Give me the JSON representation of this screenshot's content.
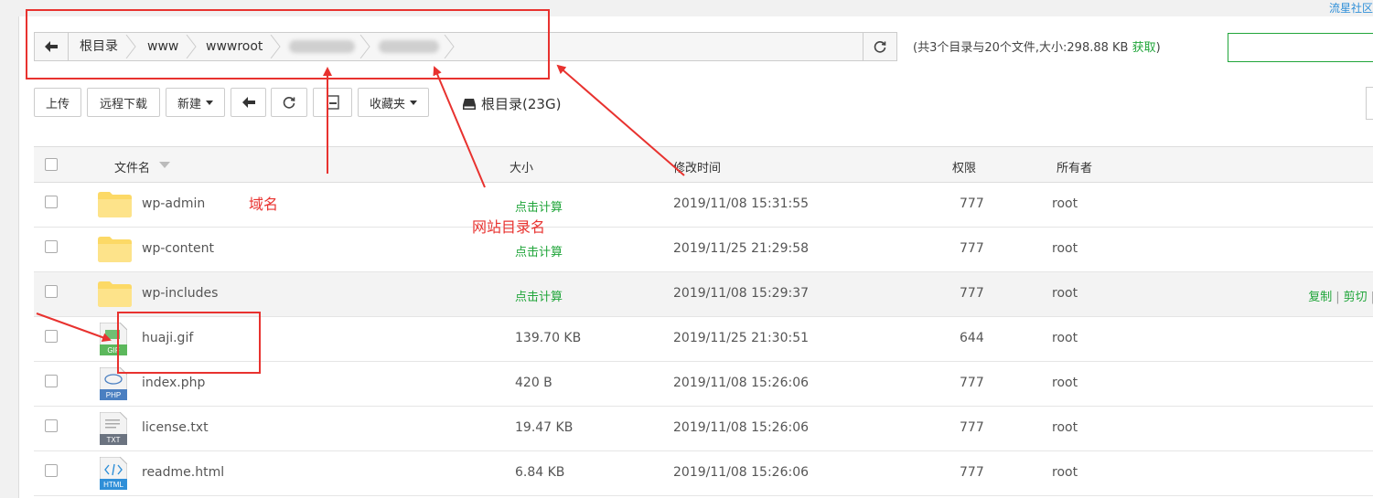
{
  "top_link": "流星社区",
  "breadcrumb": {
    "items": [
      "根目录",
      "www",
      "wwwroot"
    ]
  },
  "summary": {
    "text": "(共3个目录与20个文件,大小:298.88 KB",
    "get_label": "获取",
    "close": ")"
  },
  "toolbar": {
    "upload": "上传",
    "remote_download": "远程下载",
    "new": "新建",
    "favorites": "收藏夹",
    "disk_label": "根目录(23G)"
  },
  "table": {
    "headers": {
      "name": "文件名",
      "size": "大小",
      "mtime": "修改时间",
      "perm": "权限",
      "owner": "所有者"
    },
    "rows": [
      {
        "type": "folder",
        "name": "wp-admin",
        "size": "点击计算",
        "mtime": "2019/11/08 15:31:55",
        "perm": "777",
        "owner": "root"
      },
      {
        "type": "folder",
        "name": "wp-content",
        "size": "点击计算",
        "mtime": "2019/11/25 21:29:58",
        "perm": "777",
        "owner": "root"
      },
      {
        "type": "folder",
        "name": "wp-includes",
        "size": "点击计算",
        "mtime": "2019/11/08 15:29:37",
        "perm": "777",
        "owner": "root"
      },
      {
        "type": "GIF",
        "name": "huaji.gif",
        "size": "139.70 KB",
        "mtime": "2019/11/25 21:30:51",
        "perm": "644",
        "owner": "root"
      },
      {
        "type": "PHP",
        "name": "index.php",
        "size": "420 B",
        "mtime": "2019/11/08 15:26:06",
        "perm": "777",
        "owner": "root"
      },
      {
        "type": "TXT",
        "name": "license.txt",
        "size": "19.47 KB",
        "mtime": "2019/11/08 15:26:06",
        "perm": "777",
        "owner": "root"
      },
      {
        "type": "HTML",
        "name": "readme.html",
        "size": "6.84 KB",
        "mtime": "2019/11/08 15:26:06",
        "perm": "777",
        "owner": "root"
      }
    ],
    "row_actions": {
      "copy": "复制",
      "cut": "剪切"
    }
  },
  "annotations": {
    "domain": "域名",
    "site_dir": "网站目录名"
  },
  "colors": {
    "accent_green": "#20a53a",
    "annotation_red": "#e8322f"
  }
}
